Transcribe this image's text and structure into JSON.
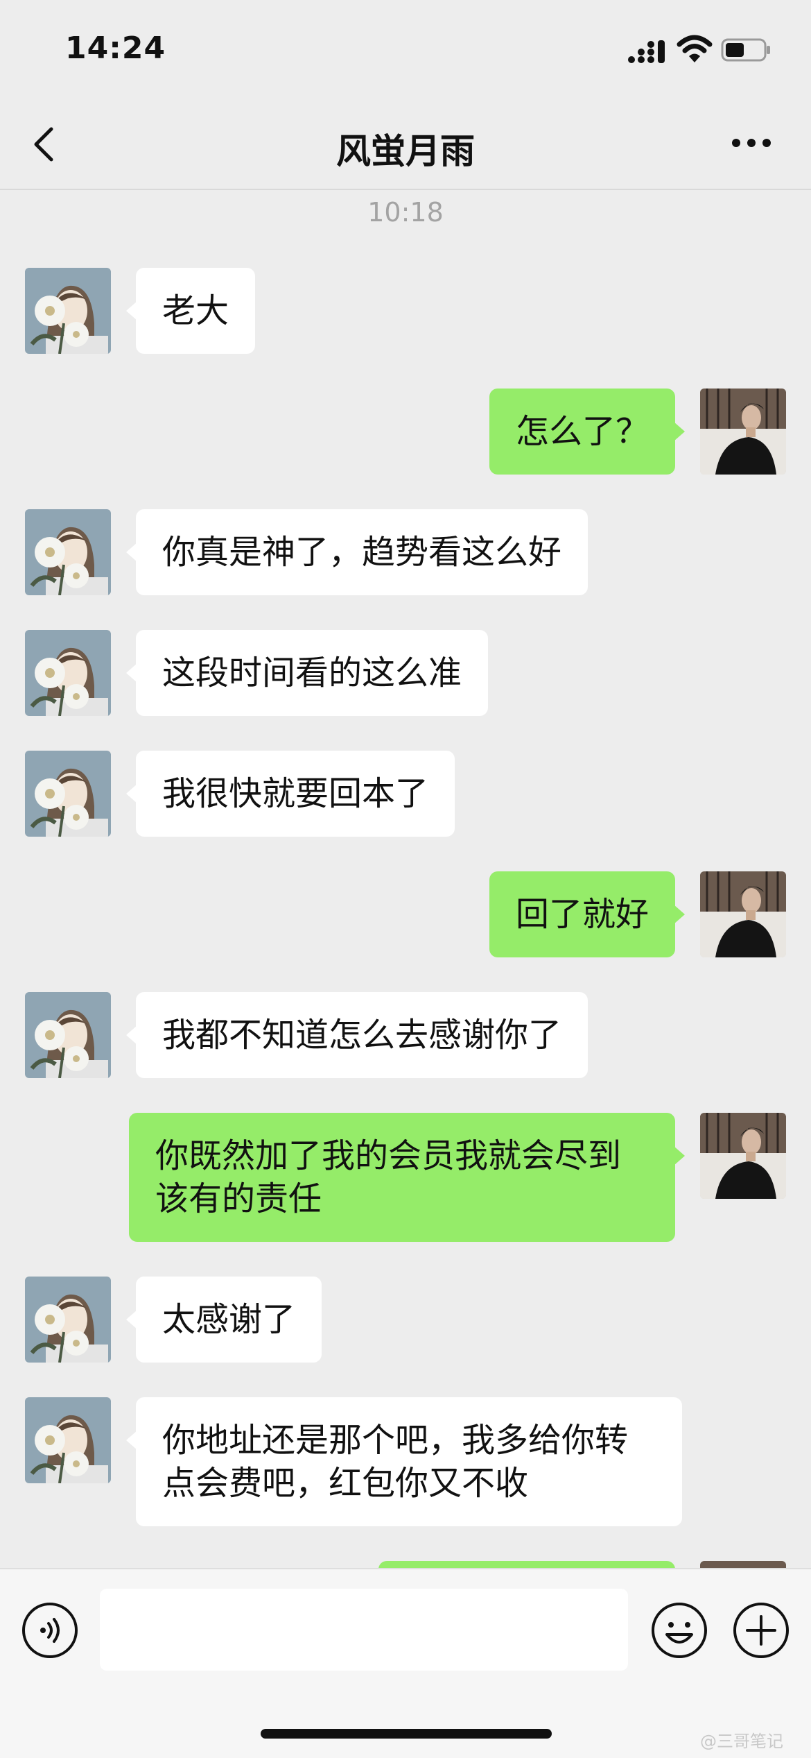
{
  "status_bar": {
    "time": "14:24"
  },
  "header": {
    "title": "风蛍月雨",
    "back_icon": "chevron-left-icon",
    "more_icon": "ellipsis-icon"
  },
  "messages": {
    "timestamp": "10:18",
    "items": [
      {
        "side": "in",
        "text": "老大"
      },
      {
        "side": "out",
        "text": "怎么了？"
      },
      {
        "side": "in",
        "text": "你真是神了，趋势看这么好"
      },
      {
        "side": "in",
        "text": "这段时间看的这么准"
      },
      {
        "side": "in",
        "text": "我很快就要回本了"
      },
      {
        "side": "out",
        "text": "回了就好"
      },
      {
        "side": "in",
        "text": "我都不知道怎么去感谢你了"
      },
      {
        "side": "out",
        "text": "你既然加了我的会员我就会尽到该有的责任"
      },
      {
        "side": "in",
        "text": "太感谢了"
      },
      {
        "side": "in",
        "text": "你地址还是那个吧，我多给你转点会费吧，红包你又不收"
      }
    ]
  },
  "input_bar": {
    "voice_icon": "voice-icon",
    "emoji_icon": "emoji-icon",
    "plus_icon": "plus-icon",
    "value": ""
  },
  "watermark": "@三哥笔记",
  "colors": {
    "incoming_bubble": "#ffffff",
    "outgoing_bubble": "#95ec69",
    "background": "#ededed"
  }
}
